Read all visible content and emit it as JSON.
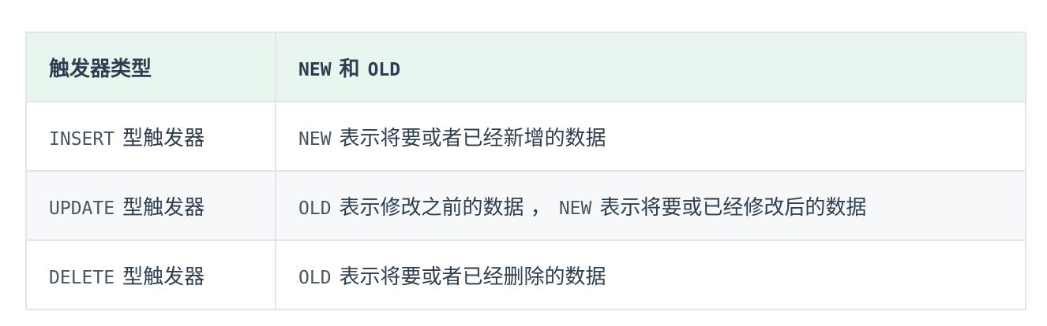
{
  "table": {
    "header": {
      "col1": "触发器类型",
      "col2_code1": "NEW",
      "col2_text": "和",
      "col2_code2": "OLD"
    },
    "rows": [
      {
        "type_code": "INSERT",
        "type_text": "型触发器",
        "desc_code1": "NEW",
        "desc_text1": "表示将要或者已经新增的数据",
        "desc_code2": "",
        "desc_text2": ""
      },
      {
        "type_code": "UPDATE",
        "type_text": "型触发器",
        "desc_code1": "OLD",
        "desc_text1": "表示修改之前的数据 ，",
        "desc_code2": "NEW",
        "desc_text2": "表示将要或已经修改后的数据"
      },
      {
        "type_code": "DELETE",
        "type_text": "型触发器",
        "desc_code1": "OLD",
        "desc_text1": "表示将要或者已经删除的数据",
        "desc_code2": "",
        "desc_text2": ""
      }
    ]
  }
}
